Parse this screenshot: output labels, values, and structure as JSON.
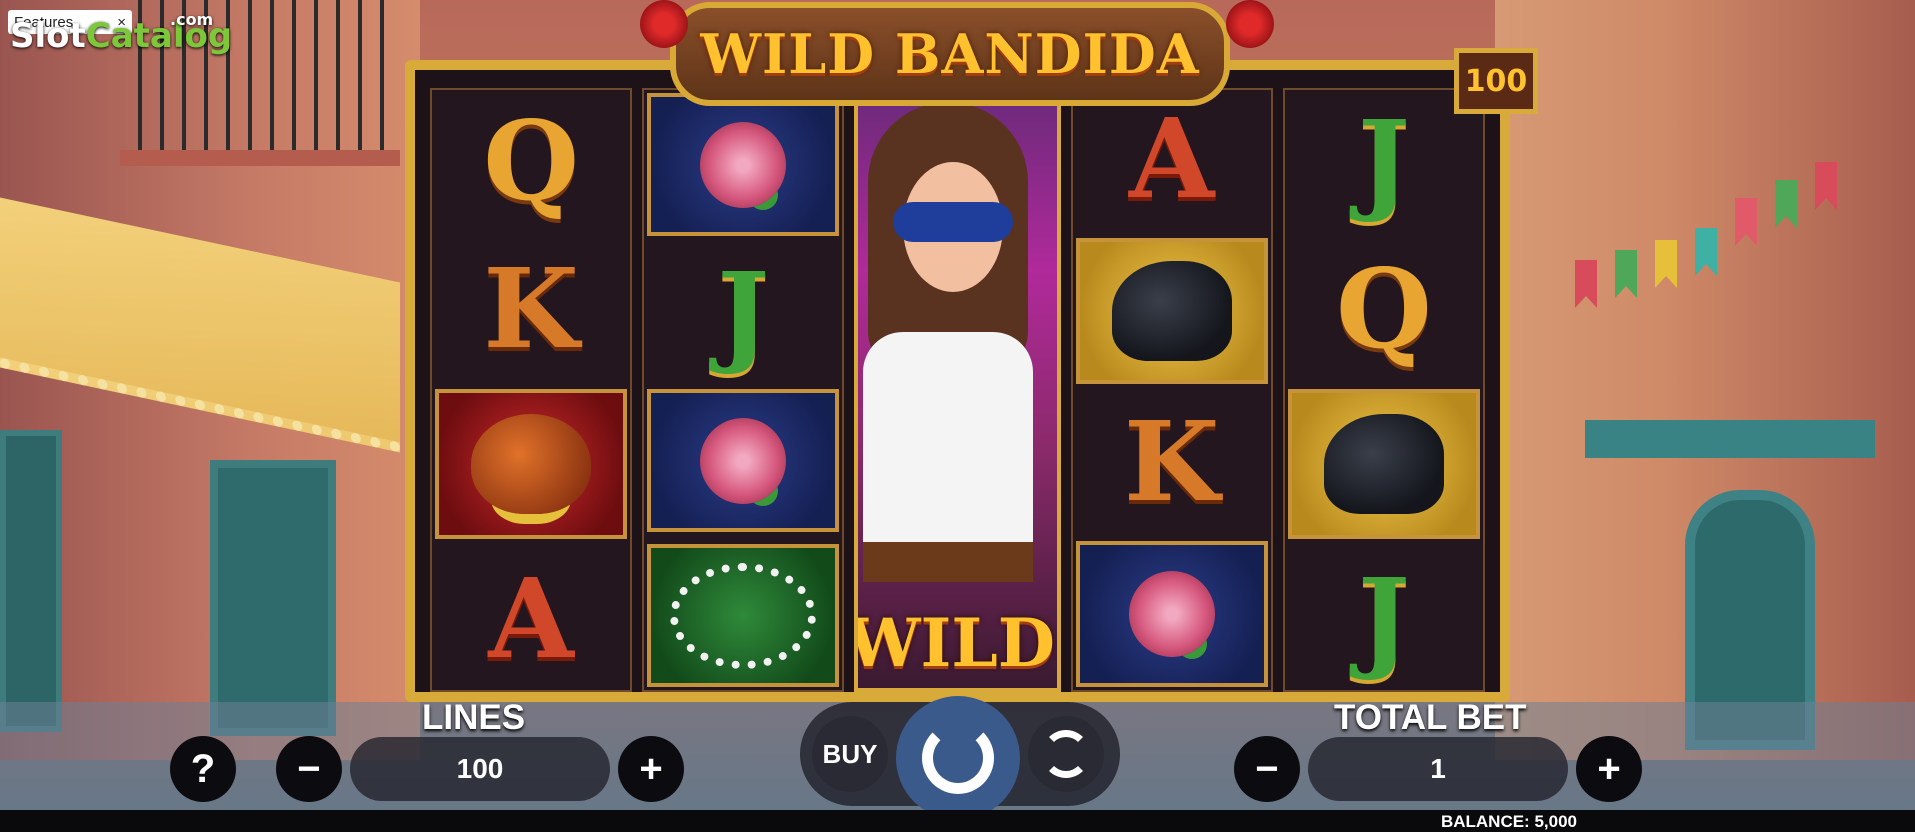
{
  "app": {
    "logo_text": "Slot",
    "logo_accent": "Catalog",
    "logo_suffix": ".com",
    "dropdown_value": "Features",
    "dropdown_arrow": "×"
  },
  "game": {
    "title": "WILD BANDIDA",
    "lines_badge": "100",
    "wild_label": "WILD"
  },
  "reels": [
    [
      "Q",
      "K",
      "bag",
      "A"
    ],
    [
      "rose",
      "J",
      "rose",
      "pearl"
    ],
    [
      "wild-bandida"
    ],
    [
      "A",
      "horse",
      "K",
      "rose"
    ],
    [
      "J",
      "Q",
      "horse",
      "J"
    ]
  ],
  "controls": {
    "help_label": "?",
    "lines_label": "LINES",
    "lines_value": "100",
    "minus_label": "−",
    "plus_label": "+",
    "buy_label": "BUY",
    "total_bet_label": "TOTAL BET",
    "total_bet_value": "1",
    "balance_text": "BALANCE: 5,000"
  },
  "icons": [
    "help-icon",
    "minus-icon",
    "plus-icon",
    "spin-icon",
    "autoplay-icon"
  ],
  "colors": {
    "gold": "#d7aa3a",
    "title": "#ffc12e",
    "spin": "#3b5a8c"
  }
}
